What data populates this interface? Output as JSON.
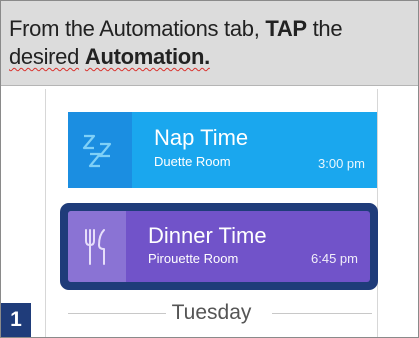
{
  "instruction": {
    "part1": "From the Automations tab, ",
    "tap": "TAP",
    "part2": " the",
    "desired": "desired",
    "automation": "Automation."
  },
  "automations": [
    {
      "title": "Nap Time",
      "room": "Duette Room",
      "time": "3:00 pm",
      "icon": "zzz-icon",
      "color": "#1aa7ee"
    },
    {
      "title": "Dinner Time",
      "room": "Pirouette Room",
      "time": "6:45 pm",
      "icon": "fork-knife-icon",
      "color": "#7153c9"
    }
  ],
  "section_label": "Tuesday",
  "step_number": "1",
  "colors": {
    "highlight": "#1f3c7a",
    "header_bg": "#dcdcdc"
  }
}
